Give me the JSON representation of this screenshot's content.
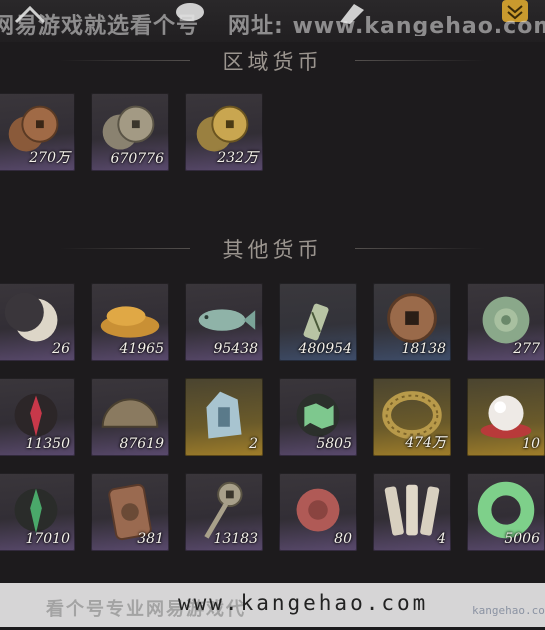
{
  "watermark_top": {
    "line1": "网易游戏就选看个号",
    "line2": "网址: www.kangehao.com"
  },
  "sections": {
    "regional": {
      "title": "区域货币"
    },
    "other": {
      "title": "其他货币"
    }
  },
  "regional_items": [
    {
      "icon": "copper-coins-icon",
      "qty": "270万",
      "rarity": "purple"
    },
    {
      "icon": "silver-coins-icon",
      "qty": "670776",
      "rarity": "purple"
    },
    {
      "icon": "gold-coins-icon",
      "qty": "232万",
      "rarity": "purple"
    }
  ],
  "other_items": [
    {
      "icon": "crescent-moon-icon",
      "qty": "26",
      "rarity": "purple"
    },
    {
      "icon": "grain-pile-icon",
      "qty": "41965",
      "rarity": "purple"
    },
    {
      "icon": "jade-fish-icon",
      "qty": "95438",
      "rarity": "purple"
    },
    {
      "icon": "jade-tablet-icon",
      "qty": "480954",
      "rarity": "blue"
    },
    {
      "icon": "square-hole-coin-icon",
      "qty": "18138",
      "rarity": "blue"
    },
    {
      "icon": "jade-disc-icon",
      "qty": "277",
      "rarity": "purple"
    },
    {
      "icon": "red-sigil-icon",
      "qty": "11350",
      "rarity": "purple"
    },
    {
      "icon": "bronze-half-disc-icon",
      "qty": "87619",
      "rarity": "purple"
    },
    {
      "icon": "jade-stone-icon",
      "qty": "2",
      "rarity": "gold"
    },
    {
      "icon": "green-map-icon",
      "qty": "5805",
      "rarity": "purple"
    },
    {
      "icon": "coin-string-icon",
      "qty": "474万",
      "rarity": "gold"
    },
    {
      "icon": "pearl-icon",
      "qty": "10",
      "rarity": "gold"
    },
    {
      "icon": "green-sigil-icon",
      "qty": "17010",
      "rarity": "purple"
    },
    {
      "icon": "bronze-plaque-icon",
      "qty": "381",
      "rarity": "purple"
    },
    {
      "icon": "coin-sword-icon",
      "qty": "13183",
      "rarity": "purple"
    },
    {
      "icon": "red-jade-icon",
      "qty": "80",
      "rarity": "purple"
    },
    {
      "icon": "bamboo-slips-icon",
      "qty": "4",
      "rarity": "purple"
    },
    {
      "icon": "jade-ring-icon",
      "qty": "5006",
      "rarity": "purple"
    }
  ],
  "watermark_bottom": {
    "text": "看个号专业网易游戏代",
    "url": "www.kangehao.com",
    "small": "kangehao.com"
  }
}
